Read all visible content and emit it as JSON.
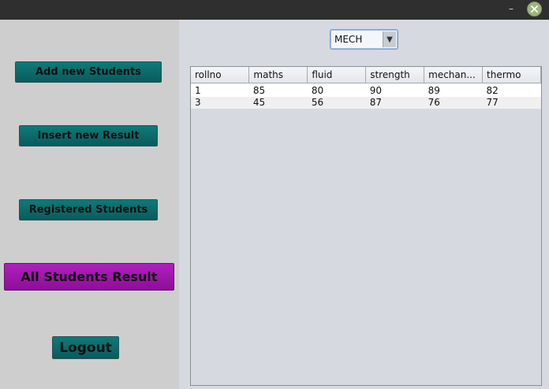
{
  "titlebar": {
    "minimize_label": "–",
    "close_icon": "close-icon"
  },
  "sidebar": {
    "add_students": "Add new Students",
    "insert_result": "Insert new Result",
    "registered": "Registered Students",
    "all_results": "All Students Result",
    "logout": "Logout"
  },
  "branch_select": {
    "value": "MECH",
    "options": [
      "MECH"
    ]
  },
  "table": {
    "headers": [
      "rollno",
      "maths",
      "fluid",
      "strength",
      "mechan...",
      "thermo"
    ],
    "rows": [
      [
        "1",
        "85",
        "80",
        "90",
        "89",
        "82"
      ],
      [
        "3",
        "45",
        "56",
        "87",
        "76",
        "77"
      ]
    ]
  },
  "colors": {
    "accent": "#0a6a6b",
    "active": "#a31ab0",
    "titlebar": "#2f2f2f"
  }
}
